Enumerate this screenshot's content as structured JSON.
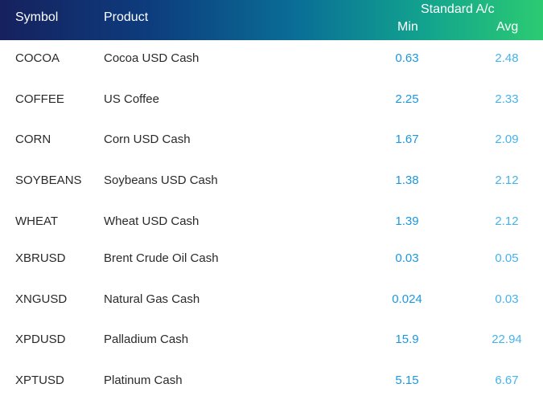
{
  "header": {
    "symbol_label": "Symbol",
    "product_label": "Product",
    "account_type_label": "Standard A/c",
    "min_label": "Min",
    "avg_label": "Avg"
  },
  "colors": {
    "header_gradient_start": "#16215e",
    "header_gradient_end": "#2bcb72",
    "header_text": "#ffffff",
    "body_text": "#2a2a2a",
    "min_value": "#1c97e0",
    "avg_value": "#46b3ea"
  },
  "rows": [
    {
      "symbol": "COCOA",
      "product": "Cocoa USD Cash",
      "min": "0.63",
      "avg": "2.48"
    },
    {
      "symbol": "COFFEE",
      "product": "US Coffee",
      "min": "2.25",
      "avg": "2.33"
    },
    {
      "symbol": "CORN",
      "product": "Corn USD Cash",
      "min": "1.67",
      "avg": "2.09"
    },
    {
      "symbol": "SOYBEANS",
      "product": "Soybeans USD Cash",
      "min": "1.38",
      "avg": "2.12"
    },
    {
      "symbol": "WHEAT",
      "product": "Wheat USD Cash",
      "min": "1.39",
      "avg": "2.12"
    },
    {
      "symbol": "XBRUSD",
      "product": "Brent Crude Oil Cash",
      "min": "0.03",
      "avg": "0.05"
    },
    {
      "symbol": "XNGUSD",
      "product": "Natural Gas Cash",
      "min": "0.024",
      "avg": "0.03"
    },
    {
      "symbol": "XPDUSD",
      "product": "Palladium Cash",
      "min": "15.9",
      "avg": "22.94"
    },
    {
      "symbol": "XPTUSD",
      "product": "Platinum Cash",
      "min": "5.15",
      "avg": "6.67"
    }
  ]
}
